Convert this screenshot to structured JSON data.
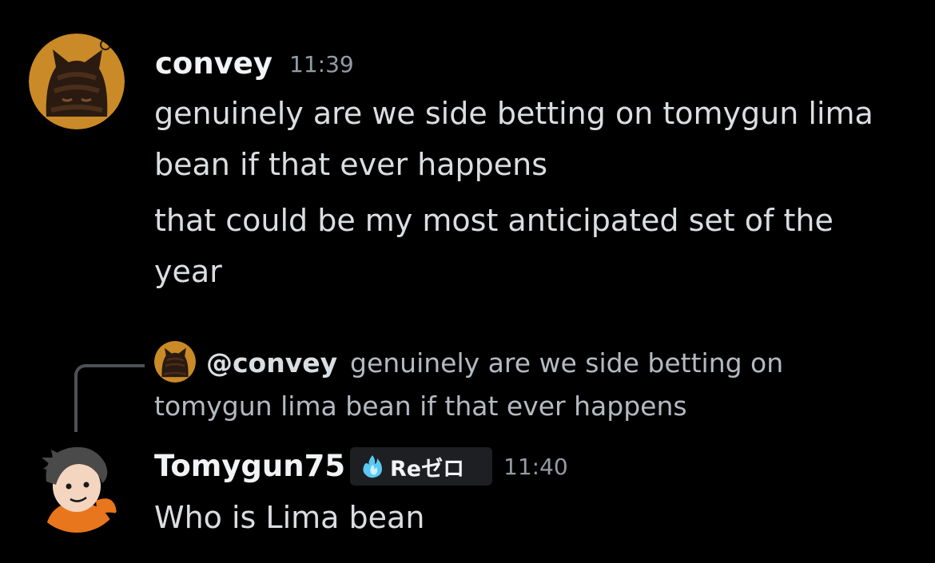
{
  "messages": [
    {
      "author": "convey",
      "time": "11:39",
      "avatar_icon": "cat-avatar-icon",
      "lines": [
        "genuinely are we side betting on tomygun lima",
        "bean if that ever happens",
        "that could be my most anticipated set of the",
        "year"
      ]
    },
    {
      "author": "Tomygun75",
      "time": "11:40",
      "avatar_icon": "cartoon-boy-avatar-icon",
      "tag": {
        "icon": "blue-flame-icon",
        "label": "Reゼロ"
      },
      "reply": {
        "author": "@convey",
        "avatar_icon": "cat-avatar-icon",
        "line1": "genuinely are we side betting on",
        "line2": "tomygun lima bean if that ever happens"
      },
      "lines": [
        "Who is Lima bean"
      ]
    }
  ],
  "colors": {
    "background": "#000000",
    "username": "#f2f3f5",
    "message_text": "#dbdee1",
    "timestamp": "#949ba4",
    "reply_text": "#b5bac1",
    "tag_background": "#1e1f22"
  }
}
